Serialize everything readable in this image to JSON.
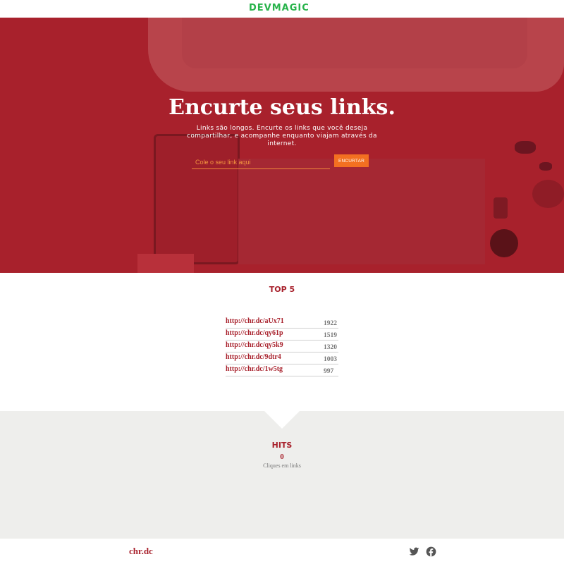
{
  "header": {
    "logo_part1": "DEV",
    "logo_part2": "MAGIC"
  },
  "hero": {
    "title": "Encurte seus links.",
    "subtitle": "Links são longos. Encurte os links que você deseja compartilhar, e acompanhe enquanto viajam através da internet.",
    "input_placeholder": "Cole o seu link aqui",
    "button_label": "ENCURTAR"
  },
  "top5": {
    "title": "TOP 5",
    "rows": [
      {
        "url": "http://chr.dc/aUx71",
        "hits": "1922"
      },
      {
        "url": "http://chr.dc/qy61p",
        "hits": "1519"
      },
      {
        "url": "http://chr.dc/qy5k9",
        "hits": "1320"
      },
      {
        "url": "http://chr.dc/9dtr4",
        "hits": "1003"
      },
      {
        "url": "http://chr.dc/1w5tg",
        "hits": "997"
      }
    ]
  },
  "hits": {
    "title": "HITS",
    "count": "0",
    "caption": "Cliques em links"
  },
  "footer": {
    "brand": "chr.dc",
    "icons": [
      "twitter-icon",
      "facebook-icon"
    ]
  },
  "colors": {
    "brand_red": "#a8212c",
    "accent_orange": "#f37021",
    "logo_green": "#27b34a",
    "hits_bg": "#eeeeec"
  }
}
